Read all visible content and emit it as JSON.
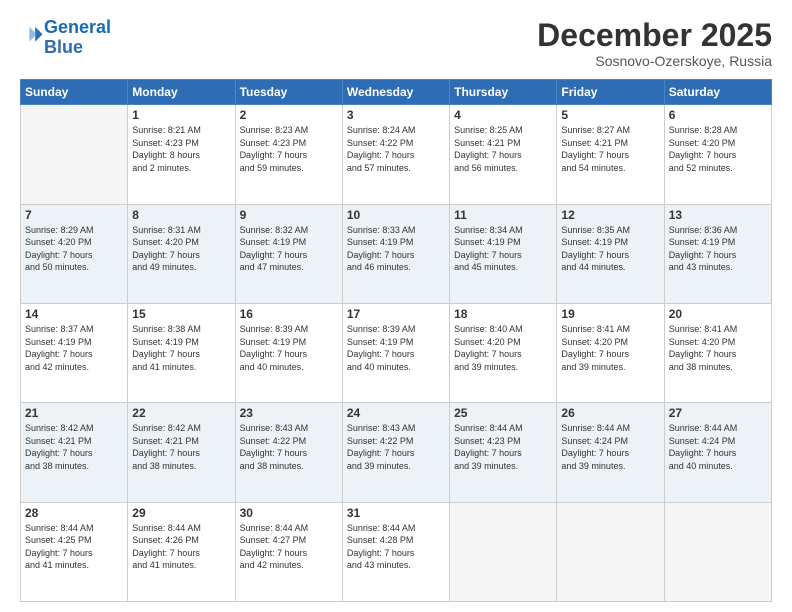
{
  "header": {
    "logo_line1": "General",
    "logo_line2": "Blue",
    "month_title": "December 2025",
    "location": "Sosnovo-Ozerskoye, Russia"
  },
  "days_of_week": [
    "Sunday",
    "Monday",
    "Tuesday",
    "Wednesday",
    "Thursday",
    "Friday",
    "Saturday"
  ],
  "weeks": [
    [
      {
        "day": "",
        "info": ""
      },
      {
        "day": "1",
        "info": "Sunrise: 8:21 AM\nSunset: 4:23 PM\nDaylight: 8 hours\nand 2 minutes."
      },
      {
        "day": "2",
        "info": "Sunrise: 8:23 AM\nSunset: 4:23 PM\nDaylight: 7 hours\nand 59 minutes."
      },
      {
        "day": "3",
        "info": "Sunrise: 8:24 AM\nSunset: 4:22 PM\nDaylight: 7 hours\nand 57 minutes."
      },
      {
        "day": "4",
        "info": "Sunrise: 8:25 AM\nSunset: 4:21 PM\nDaylight: 7 hours\nand 56 minutes."
      },
      {
        "day": "5",
        "info": "Sunrise: 8:27 AM\nSunset: 4:21 PM\nDaylight: 7 hours\nand 54 minutes."
      },
      {
        "day": "6",
        "info": "Sunrise: 8:28 AM\nSunset: 4:20 PM\nDaylight: 7 hours\nand 52 minutes."
      }
    ],
    [
      {
        "day": "7",
        "info": "Sunrise: 8:29 AM\nSunset: 4:20 PM\nDaylight: 7 hours\nand 50 minutes."
      },
      {
        "day": "8",
        "info": "Sunrise: 8:31 AM\nSunset: 4:20 PM\nDaylight: 7 hours\nand 49 minutes."
      },
      {
        "day": "9",
        "info": "Sunrise: 8:32 AM\nSunset: 4:19 PM\nDaylight: 7 hours\nand 47 minutes."
      },
      {
        "day": "10",
        "info": "Sunrise: 8:33 AM\nSunset: 4:19 PM\nDaylight: 7 hours\nand 46 minutes."
      },
      {
        "day": "11",
        "info": "Sunrise: 8:34 AM\nSunset: 4:19 PM\nDaylight: 7 hours\nand 45 minutes."
      },
      {
        "day": "12",
        "info": "Sunrise: 8:35 AM\nSunset: 4:19 PM\nDaylight: 7 hours\nand 44 minutes."
      },
      {
        "day": "13",
        "info": "Sunrise: 8:36 AM\nSunset: 4:19 PM\nDaylight: 7 hours\nand 43 minutes."
      }
    ],
    [
      {
        "day": "14",
        "info": "Sunrise: 8:37 AM\nSunset: 4:19 PM\nDaylight: 7 hours\nand 42 minutes."
      },
      {
        "day": "15",
        "info": "Sunrise: 8:38 AM\nSunset: 4:19 PM\nDaylight: 7 hours\nand 41 minutes."
      },
      {
        "day": "16",
        "info": "Sunrise: 8:39 AM\nSunset: 4:19 PM\nDaylight: 7 hours\nand 40 minutes."
      },
      {
        "day": "17",
        "info": "Sunrise: 8:39 AM\nSunset: 4:19 PM\nDaylight: 7 hours\nand 40 minutes."
      },
      {
        "day": "18",
        "info": "Sunrise: 8:40 AM\nSunset: 4:20 PM\nDaylight: 7 hours\nand 39 minutes."
      },
      {
        "day": "19",
        "info": "Sunrise: 8:41 AM\nSunset: 4:20 PM\nDaylight: 7 hours\nand 39 minutes."
      },
      {
        "day": "20",
        "info": "Sunrise: 8:41 AM\nSunset: 4:20 PM\nDaylight: 7 hours\nand 38 minutes."
      }
    ],
    [
      {
        "day": "21",
        "info": "Sunrise: 8:42 AM\nSunset: 4:21 PM\nDaylight: 7 hours\nand 38 minutes."
      },
      {
        "day": "22",
        "info": "Sunrise: 8:42 AM\nSunset: 4:21 PM\nDaylight: 7 hours\nand 38 minutes."
      },
      {
        "day": "23",
        "info": "Sunrise: 8:43 AM\nSunset: 4:22 PM\nDaylight: 7 hours\nand 38 minutes."
      },
      {
        "day": "24",
        "info": "Sunrise: 8:43 AM\nSunset: 4:22 PM\nDaylight: 7 hours\nand 39 minutes."
      },
      {
        "day": "25",
        "info": "Sunrise: 8:44 AM\nSunset: 4:23 PM\nDaylight: 7 hours\nand 39 minutes."
      },
      {
        "day": "26",
        "info": "Sunrise: 8:44 AM\nSunset: 4:24 PM\nDaylight: 7 hours\nand 39 minutes."
      },
      {
        "day": "27",
        "info": "Sunrise: 8:44 AM\nSunset: 4:24 PM\nDaylight: 7 hours\nand 40 minutes."
      }
    ],
    [
      {
        "day": "28",
        "info": "Sunrise: 8:44 AM\nSunset: 4:25 PM\nDaylight: 7 hours\nand 41 minutes."
      },
      {
        "day": "29",
        "info": "Sunrise: 8:44 AM\nSunset: 4:26 PM\nDaylight: 7 hours\nand 41 minutes."
      },
      {
        "day": "30",
        "info": "Sunrise: 8:44 AM\nSunset: 4:27 PM\nDaylight: 7 hours\nand 42 minutes."
      },
      {
        "day": "31",
        "info": "Sunrise: 8:44 AM\nSunset: 4:28 PM\nDaylight: 7 hours\nand 43 minutes."
      },
      {
        "day": "",
        "info": ""
      },
      {
        "day": "",
        "info": ""
      },
      {
        "day": "",
        "info": ""
      }
    ]
  ]
}
